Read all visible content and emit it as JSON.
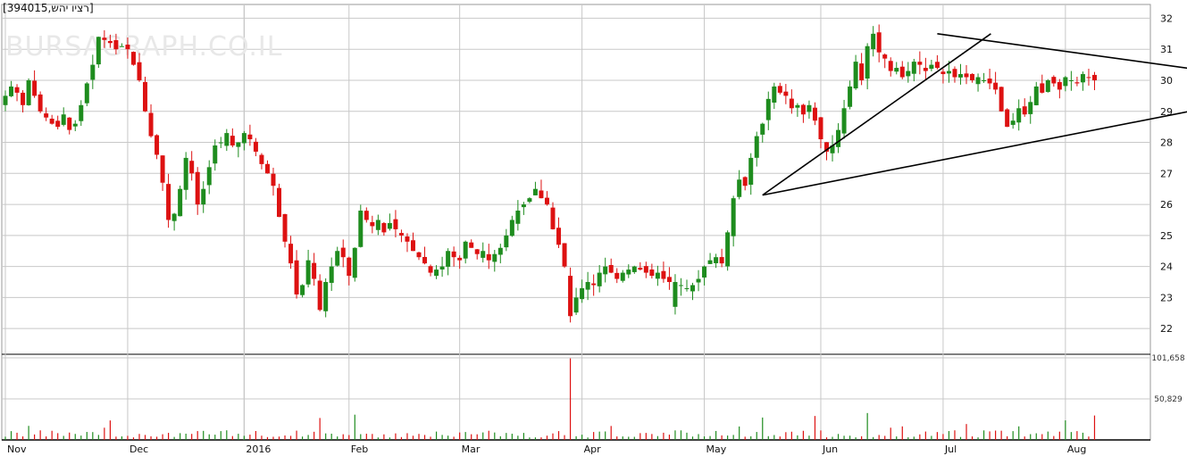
{
  "title": "[רציו יהש,394015]",
  "watermark": "BURSAGRAPH.CO.IL",
  "colors": {
    "up": "#1e8c1e",
    "down": "#dd1111",
    "grid": "#c8c8c8",
    "trendline": "#000000"
  },
  "chart_data": {
    "type": "candlestick",
    "x": [
      "Nov",
      "Dec",
      "2016",
      "Feb",
      "Mar",
      "Apr",
      "May",
      "Jun",
      "Jul",
      "Aug"
    ],
    "price_ylim": [
      21.2,
      32.3
    ],
    "price_ticks": [
      "22",
      "23",
      "24",
      "25",
      "26",
      "27",
      "28",
      "29",
      "30",
      "31",
      "32"
    ],
    "volume_ticks": [
      "50,829",
      "101,658"
    ],
    "volume_ylim": [
      0,
      101658
    ],
    "grid": true,
    "closes": [
      29.5,
      29.8,
      29.6,
      29.2,
      30.0,
      29.5,
      29.0,
      28.8,
      28.6,
      28.5,
      28.9,
      28.4,
      28.6,
      29.2,
      29.9,
      30.5,
      31.4,
      31.3,
      31.2,
      31.0,
      31.1,
      31.0,
      30.5,
      30.0,
      29.0,
      28.2,
      27.6,
      26.7,
      25.5,
      25.7,
      26.5,
      27.5,
      27.0,
      26.0,
      26.5,
      27.2,
      27.9,
      28.0,
      28.3,
      27.9,
      28.0,
      28.3,
      28.1,
      27.7,
      27.3,
      27.0,
      26.6,
      25.6,
      24.8,
      24.1,
      23.1,
      23.4,
      24.2,
      23.6,
      22.6,
      23.5,
      24.0,
      24.5,
      24.3,
      23.7,
      24.6,
      25.8,
      25.5,
      25.3,
      25.5,
      25.1,
      25.4,
      25.2,
      25.0,
      24.8,
      24.5,
      24.3,
      24.1,
      23.8,
      23.9,
      24.0,
      24.5,
      24.3,
      24.2,
      24.8,
      24.6,
      24.4,
      24.5,
      24.2,
      24.4,
      24.6,
      25.0,
      25.5,
      25.8,
      26.0,
      26.2,
      26.5,
      26.2,
      26.0,
      25.2,
      24.7,
      24.0,
      22.4,
      23.0,
      23.3,
      23.5,
      23.4,
      23.8,
      24.0,
      23.8,
      23.6,
      23.8,
      23.9,
      24.0,
      23.9,
      23.8,
      23.7,
      23.8,
      23.6,
      23.5,
      23.5,
      23.4,
      23.3,
      23.4,
      23.6,
      24.0,
      24.2,
      24.3,
      24.1,
      25.1,
      26.2,
      26.8,
      26.6,
      27.5,
      28.2,
      28.6,
      29.4,
      29.8,
      29.6,
      29.5,
      29.1,
      29.2,
      28.9,
      29.2,
      28.7,
      28.1,
      27.7,
      27.9,
      28.4,
      29.1,
      29.8,
      30.6,
      30.0,
      31.1,
      31.5,
      30.9,
      30.7,
      30.3,
      30.4,
      30.1,
      30.3,
      30.6,
      30.5,
      30.3,
      30.5,
      30.4,
      30.2,
      30.3,
      30.1,
      30.2,
      30.1,
      30.0,
      30.1,
      30.0,
      29.9,
      29.7,
      29.0,
      28.5,
      28.7,
      29.1,
      28.9,
      29.3,
      29.8,
      29.6,
      30.0,
      29.9,
      29.7,
      30.1,
      30.0,
      29.9,
      30.2,
      30.1,
      30.0
    ],
    "gaps": [
      [
        115,
        0.8
      ],
      [
        97,
        0.3
      ]
    ],
    "trendlines": [
      {
        "from": [
          130,
          26.3
        ],
        "to": [
          160,
          31.5
        ],
        "label": ""
      },
      {
        "from": [
          160,
          31.5
        ],
        "to": [
          205,
          30.1
        ],
        "label": ""
      },
      {
        "from": [
          130,
          26.3
        ],
        "to": [
          205,
          29.4
        ],
        "label": ""
      }
    ],
    "volume_note": "volume bars per session, red/green matching candles"
  }
}
